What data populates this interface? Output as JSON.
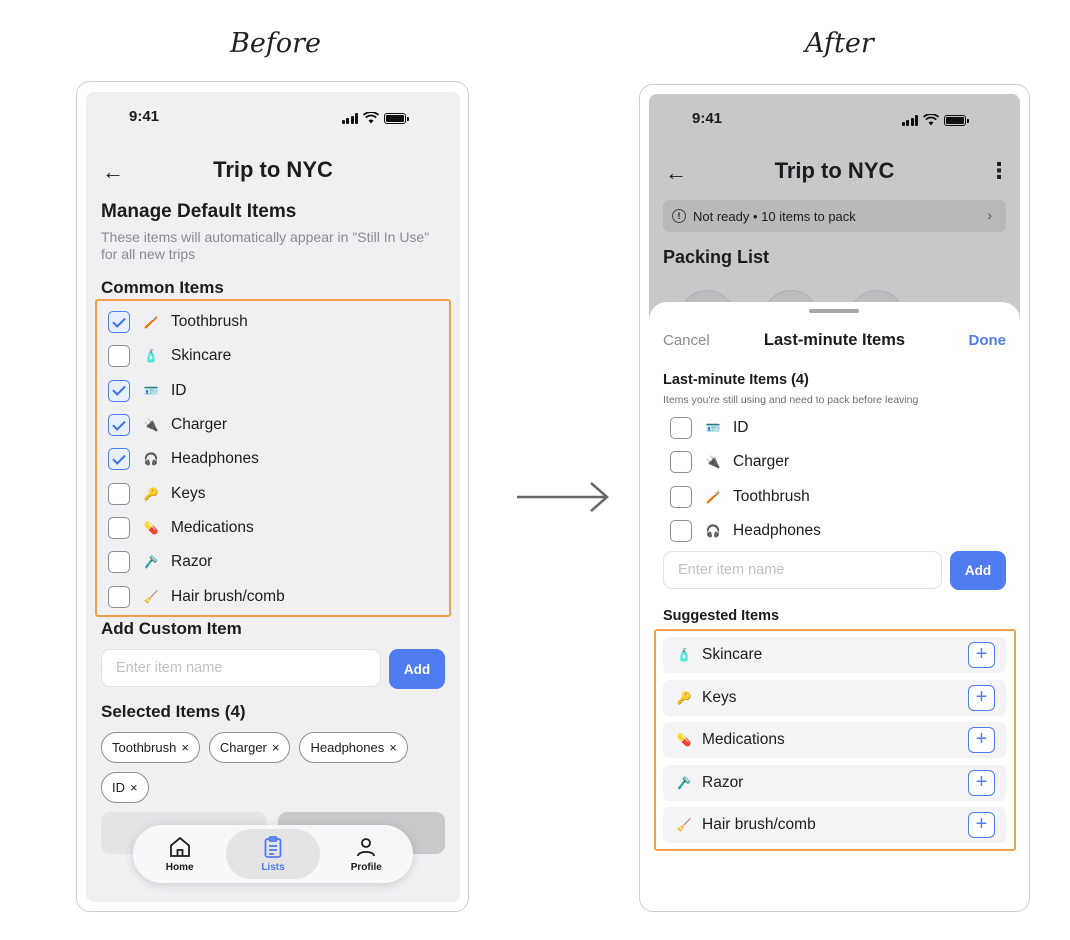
{
  "captions": {
    "before": "Before",
    "after": "After"
  },
  "before": {
    "status": {
      "time": "9:41"
    },
    "header": {
      "title": "Trip to NYC",
      "back": "←"
    },
    "section_title": "Manage Default Items",
    "description": "These items will automatically appear in \"Still In Use\" for all new trips",
    "common_title": "Common Items",
    "items": [
      {
        "emoji": "🪥",
        "label": "Toothbrush",
        "checked": true
      },
      {
        "emoji": "🧴",
        "label": "Skincare",
        "checked": false
      },
      {
        "emoji": "🪪",
        "label": "ID",
        "checked": true
      },
      {
        "emoji": "🔌",
        "label": "Charger",
        "checked": true
      },
      {
        "emoji": "🎧",
        "label": "Headphones",
        "checked": true
      },
      {
        "emoji": "🔑",
        "label": "Keys",
        "checked": false
      },
      {
        "emoji": "💊",
        "label": "Medications",
        "checked": false
      },
      {
        "emoji": "🪒",
        "label": "Razor",
        "checked": false
      },
      {
        "emoji": "🧹",
        "label": "Hair brush/comb",
        "checked": false
      }
    ],
    "add_custom_title": "Add Custom Item",
    "input_placeholder": "Enter item name",
    "add_label": "Add",
    "selected_title": "Selected Items (4)",
    "chips": [
      "Toothbrush",
      "Charger",
      "Headphones",
      "ID"
    ],
    "chip_remove": "×",
    "tabs": [
      {
        "label": "Home",
        "icon": "home-icon",
        "active": false
      },
      {
        "label": "Lists",
        "icon": "clipboard-icon",
        "active": true
      },
      {
        "label": "Profile",
        "icon": "person-icon",
        "active": false
      }
    ]
  },
  "after": {
    "status": {
      "time": "9:41"
    },
    "header": {
      "title": "Trip to NYC",
      "back": "←",
      "more": "⋮"
    },
    "banner": {
      "text": "Not ready • 10 items to pack",
      "info": "!",
      "chevron": "›"
    },
    "packing_title": "Packing List",
    "sheet": {
      "cancel": "Cancel",
      "title": "Last-minute Items",
      "done": "Done",
      "section_title": "Last-minute Items (4)",
      "section_sub": "Items you're still using and need to pack before leaving",
      "items": [
        {
          "emoji": "🪪",
          "label": "ID"
        },
        {
          "emoji": "🔌",
          "label": "Charger"
        },
        {
          "emoji": "🪥",
          "label": "Toothbrush"
        },
        {
          "emoji": "🎧",
          "label": "Headphones"
        }
      ],
      "input_placeholder": "Enter item name",
      "add_label": "Add",
      "suggested_title": "Suggested Items",
      "suggested": [
        {
          "emoji": "🧴",
          "label": "Skincare"
        },
        {
          "emoji": "🔑",
          "label": "Keys"
        },
        {
          "emoji": "💊",
          "label": "Medications"
        },
        {
          "emoji": "🪒",
          "label": "Razor"
        },
        {
          "emoji": "🧹",
          "label": "Hair brush/comb"
        }
      ],
      "plus": "+"
    }
  },
  "colors": {
    "accent": "#4f7cf0",
    "highlight": "#f0a04b",
    "muted": "#8a8a90"
  }
}
